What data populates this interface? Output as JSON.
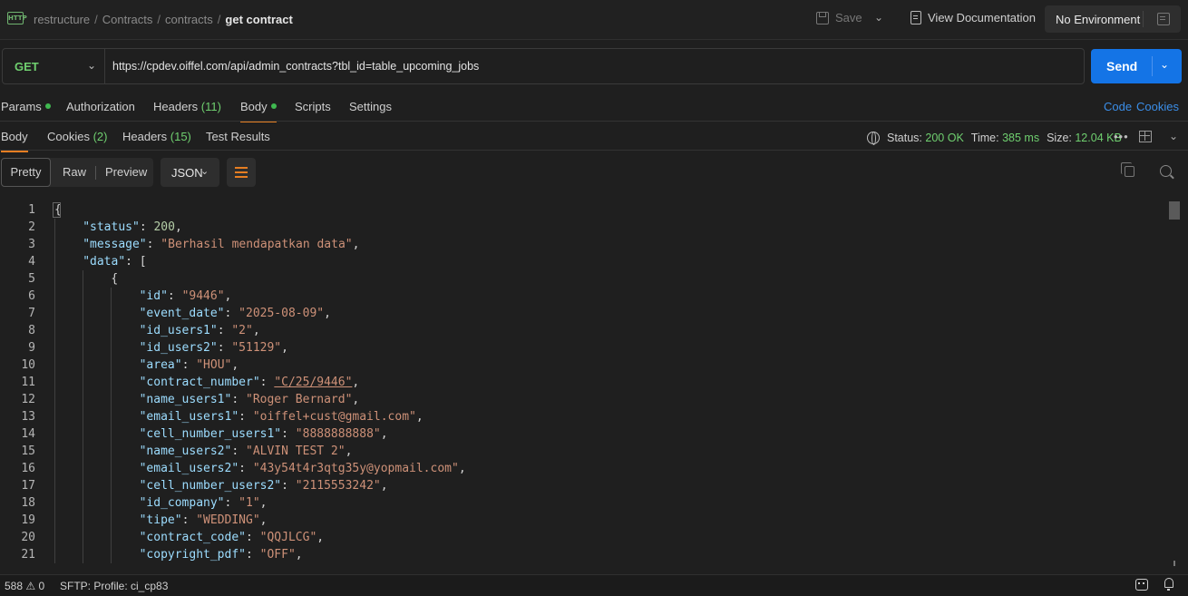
{
  "header": {
    "breadcrumb": [
      "restructure",
      "Contracts",
      "contracts"
    ],
    "current": "get contract",
    "save_label": "Save",
    "view_doc_label": "View Documentation",
    "environment": "No Environment"
  },
  "request": {
    "method": "GET",
    "url": "https://cpdev.oiffel.com/api/admin_contracts?tbl_id=table_upcoming_jobs",
    "send_label": "Send"
  },
  "request_tabs": {
    "params": "Params",
    "authorization": "Authorization",
    "headers": "Headers",
    "headers_count": "(11)",
    "body": "Body",
    "scripts": "Scripts",
    "settings": "Settings",
    "code_link": "Code",
    "cookies_link": "Cookies"
  },
  "response_tabs": {
    "body": "Body",
    "cookies": "Cookies",
    "cookies_count": "(2)",
    "headers": "Headers",
    "headers_count": "(15)",
    "test_results": "Test Results"
  },
  "response_meta": {
    "status_label": "Status:",
    "status_value": "200 OK",
    "time_label": "Time:",
    "time_value": "385 ms",
    "size_label": "Size:",
    "size_value": "12.04 KB"
  },
  "view": {
    "modes": [
      "Pretty",
      "Raw",
      "Preview"
    ],
    "format": "JSON"
  },
  "code_lines": [
    {
      "n": "1",
      "parts": [
        [
          "p",
          "{"
        ]
      ]
    },
    {
      "n": "2",
      "parts": [
        [
          "k",
          "\"status\""
        ],
        [
          "p",
          ": "
        ],
        [
          "n",
          "200"
        ],
        [
          "p",
          ","
        ]
      ]
    },
    {
      "n": "3",
      "parts": [
        [
          "k",
          "\"message\""
        ],
        [
          "p",
          ": "
        ],
        [
          "s",
          "\"Berhasil mendapatkan data\""
        ],
        [
          "p",
          ","
        ]
      ]
    },
    {
      "n": "4",
      "parts": [
        [
          "k",
          "\"data\""
        ],
        [
          "p",
          ": ["
        ]
      ]
    },
    {
      "n": "5",
      "parts": [
        [
          "p",
          "{"
        ]
      ]
    },
    {
      "n": "6",
      "parts": [
        [
          "k",
          "\"id\""
        ],
        [
          "p",
          ": "
        ],
        [
          "s",
          "\"9446\""
        ],
        [
          "p",
          ","
        ]
      ]
    },
    {
      "n": "7",
      "parts": [
        [
          "k",
          "\"event_date\""
        ],
        [
          "p",
          ": "
        ],
        [
          "s",
          "\"2025-08-09\""
        ],
        [
          "p",
          ","
        ]
      ]
    },
    {
      "n": "8",
      "parts": [
        [
          "k",
          "\"id_users1\""
        ],
        [
          "p",
          ": "
        ],
        [
          "s",
          "\"2\""
        ],
        [
          "p",
          ","
        ]
      ]
    },
    {
      "n": "9",
      "parts": [
        [
          "k",
          "\"id_users2\""
        ],
        [
          "p",
          ": "
        ],
        [
          "s",
          "\"51129\""
        ],
        [
          "p",
          ","
        ]
      ]
    },
    {
      "n": "10",
      "parts": [
        [
          "k",
          "\"area\""
        ],
        [
          "p",
          ": "
        ],
        [
          "s",
          "\"HOU\""
        ],
        [
          "p",
          ","
        ]
      ]
    },
    {
      "n": "11",
      "parts": [
        [
          "k",
          "\"contract_number\""
        ],
        [
          "p",
          ": "
        ],
        [
          "s",
          "\"C/25/9446\""
        ],
        [
          "p",
          ","
        ]
      ]
    },
    {
      "n": "12",
      "parts": [
        [
          "k",
          "\"name_users1\""
        ],
        [
          "p",
          ": "
        ],
        [
          "s",
          "\"Roger Bernard\""
        ],
        [
          "p",
          ","
        ]
      ]
    },
    {
      "n": "13",
      "parts": [
        [
          "k",
          "\"email_users1\""
        ],
        [
          "p",
          ": "
        ],
        [
          "s",
          "\"oiffel+cust@gmail.com\""
        ],
        [
          "p",
          ","
        ]
      ]
    },
    {
      "n": "14",
      "parts": [
        [
          "k",
          "\"cell_number_users1\""
        ],
        [
          "p",
          ": "
        ],
        [
          "s",
          "\"8888888888\""
        ],
        [
          "p",
          ","
        ]
      ]
    },
    {
      "n": "15",
      "parts": [
        [
          "k",
          "\"name_users2\""
        ],
        [
          "p",
          ": "
        ],
        [
          "s",
          "\"ALVIN TEST 2\""
        ],
        [
          "p",
          ","
        ]
      ]
    },
    {
      "n": "16",
      "parts": [
        [
          "k",
          "\"email_users2\""
        ],
        [
          "p",
          ": "
        ],
        [
          "s",
          "\"43y54t4r3qtg35y@yopmail.com\""
        ],
        [
          "p",
          ","
        ]
      ]
    },
    {
      "n": "17",
      "parts": [
        [
          "k",
          "\"cell_number_users2\""
        ],
        [
          "p",
          ": "
        ],
        [
          "s",
          "\"2115553242\""
        ],
        [
          "p",
          ","
        ]
      ]
    },
    {
      "n": "18",
      "parts": [
        [
          "k",
          "\"id_company\""
        ],
        [
          "p",
          ": "
        ],
        [
          "s",
          "\"1\""
        ],
        [
          "p",
          ","
        ]
      ]
    },
    {
      "n": "19",
      "parts": [
        [
          "k",
          "\"tipe\""
        ],
        [
          "p",
          ": "
        ],
        [
          "s",
          "\"WEDDING\""
        ],
        [
          "p",
          ","
        ]
      ]
    },
    {
      "n": "20",
      "parts": [
        [
          "k",
          "\"contract_code\""
        ],
        [
          "p",
          ": "
        ],
        [
          "s",
          "\"QQJLCG\""
        ],
        [
          "p",
          ","
        ]
      ]
    },
    {
      "n": "21",
      "parts": [
        [
          "k",
          "\"copyright_pdf\""
        ],
        [
          "p",
          ": "
        ],
        [
          "s",
          "\"OFF\""
        ],
        [
          "p",
          ","
        ]
      ]
    }
  ],
  "footer": {
    "line_count": "588",
    "warnings": "0",
    "sftp": "SFTP: Profile: ci_cp83"
  },
  "icons": [
    "http-icon",
    "save-icon",
    "document-icon",
    "environment-icon",
    "globe-icon",
    "layout-icon",
    "wrap-icon",
    "copy-icon",
    "search-icon",
    "warning-icon",
    "bot-icon",
    "bell-icon"
  ],
  "colors": {
    "background": "#1f1f1f",
    "accent_orange": "#e67e22",
    "send_blue": "#1474e6",
    "status_green": "#6fcf6f",
    "json_key": "#9cdcfe",
    "json_string": "#ce9178",
    "json_number": "#b5cea8"
  }
}
